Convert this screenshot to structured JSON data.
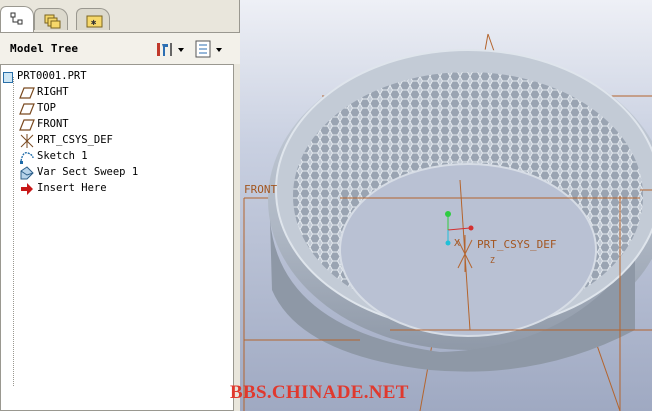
{
  "panel": {
    "title": "Model Tree",
    "tabs": [
      {
        "name": "model-tree-tab",
        "icon": "tree-icon",
        "active": true
      },
      {
        "name": "folder-browser-tab",
        "icon": "folders-icon",
        "active": false
      },
      {
        "name": "favorites-tab",
        "icon": "star-folder-icon",
        "active": false
      }
    ],
    "header_buttons": [
      {
        "name": "settings-dropdown-button",
        "icon": "tools-icon"
      },
      {
        "name": "show-dropdown-button",
        "icon": "list-icon"
      }
    ]
  },
  "tree": {
    "root": {
      "label": "PRT0001.PRT",
      "icon": "part-icon"
    },
    "items": [
      {
        "label": "RIGHT",
        "icon": "datum-plane-icon"
      },
      {
        "label": "TOP",
        "icon": "datum-plane-icon"
      },
      {
        "label": "FRONT",
        "icon": "datum-plane-icon"
      },
      {
        "label": "PRT_CSYS_DEF",
        "icon": "csys-icon"
      },
      {
        "label": "Sketch 1",
        "icon": "sketch-icon"
      },
      {
        "label": "Var Sect Sweep 1",
        "icon": "sweep-icon"
      },
      {
        "label": "Insert Here",
        "icon": "insert-arrow-icon"
      }
    ]
  },
  "viewport": {
    "labels": {
      "front": "FRONT",
      "csys": "PRT_CSYS_DEF",
      "axis_x": "X",
      "axis_z": "Z"
    },
    "colors": {
      "datum": "#b4642d",
      "csys_y": "#2ecc40",
      "csys_x": "#d43030",
      "csys_z": "#20c0d8",
      "surface": "#aab4c0"
    }
  },
  "watermark": "BBS.CHINADE.NET"
}
